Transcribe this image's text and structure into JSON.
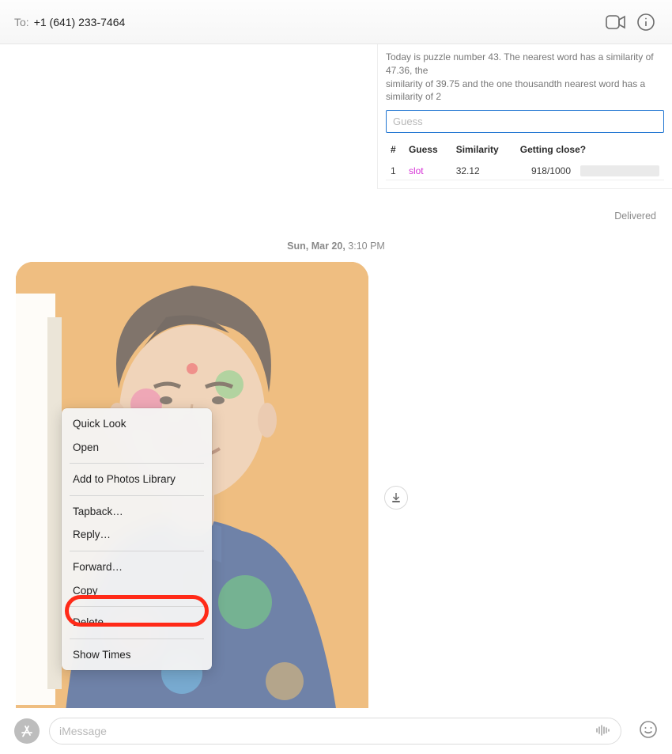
{
  "header": {
    "to_label": "To:",
    "to_value": "+1 (641) 233-7464"
  },
  "game": {
    "trunc_line1": "Today is puzzle number 43. The nearest word has a similarity of 47.36, the",
    "trunc_line2": "similarity of 39.75 and the one thousandth nearest word has a similarity of 2",
    "guess_placeholder": "Guess",
    "columns": {
      "num": "#",
      "guess": "Guess",
      "similarity": "Similarity",
      "close": "Getting close?"
    },
    "rows": [
      {
        "num": "1",
        "guess": "slot",
        "similarity": "32.12",
        "close": "918/1000"
      }
    ]
  },
  "delivered": "Delivered",
  "timestamp": {
    "day": "Sun, Mar 20,",
    "time": "3:10 PM"
  },
  "context_menu": {
    "quick_look": "Quick Look",
    "open": "Open",
    "add_photos": "Add to Photos Library",
    "tapback": "Tapback…",
    "reply": "Reply…",
    "forward": "Forward…",
    "copy": "Copy",
    "delete": "Delete…",
    "show_times": "Show Times"
  },
  "compose": {
    "placeholder": "iMessage"
  }
}
